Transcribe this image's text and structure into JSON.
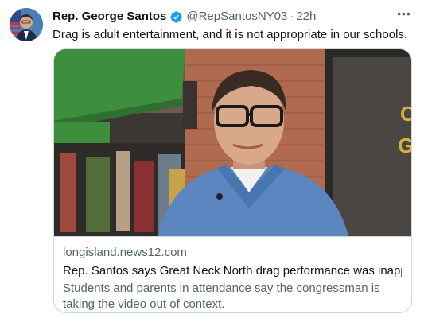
{
  "author": {
    "display_name": "Rep. George Santos",
    "handle": "@RepSantosNY03",
    "separator": "·",
    "time": "22h",
    "verified_badge": "verified-badge-icon",
    "avatar": "avatar-image"
  },
  "tweet": {
    "text": "Drag is adult entertainment, and it is not appropriate in our schools."
  },
  "menu": {
    "more_icon": "more-horizontal-icon",
    "more_label": "•••"
  },
  "link_card": {
    "image": "news-video-thumbnail",
    "domain": "longisland.news12.com",
    "title": "Rep. Santos says Great Neck North drag performance was inapprop...",
    "description": "Students and parents in attendance say the congressman is taking the video out of context."
  },
  "colors": {
    "text_primary": "#0f1419",
    "text_secondary": "#536471",
    "border": "#cfd9de",
    "verified": "#1d9bf0",
    "awning_green": "#3d8e3d"
  }
}
